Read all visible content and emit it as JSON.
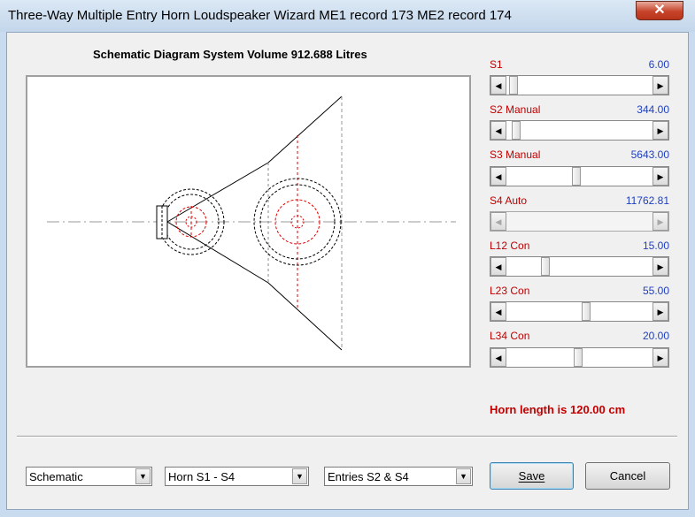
{
  "window": {
    "title": "Three-Way Multiple Entry Horn Loudspeaker Wizard   ME1 record 173   ME2 record 174",
    "close_symbol": "✕"
  },
  "diagram": {
    "heading": "Schematic Diagram   System Volume 912.688 Litres"
  },
  "sliders": [
    {
      "label": "S1",
      "value": "6.00",
      "position": 0.02,
      "enabled": true
    },
    {
      "label": "S2  Manual",
      "value": "344.00",
      "position": 0.04,
      "enabled": true
    },
    {
      "label": "S3  Manual",
      "value": "5643.00",
      "position": 0.48,
      "enabled": true
    },
    {
      "label": "S4  Auto",
      "value": "11762.81",
      "position": 0.0,
      "enabled": false
    },
    {
      "label": "L12  Con",
      "value": "15.00",
      "position": 0.25,
      "enabled": true
    },
    {
      "label": "L23  Con",
      "value": "55.00",
      "position": 0.55,
      "enabled": true
    },
    {
      "label": "L34  Con",
      "value": "20.00",
      "position": 0.49,
      "enabled": true
    }
  ],
  "horn_length_text": "Horn length is 120.00 cm",
  "combos": [
    {
      "name": "view-select",
      "value": "Schematic"
    },
    {
      "name": "horn-select",
      "value": "Horn S1 - S4"
    },
    {
      "name": "entries-select",
      "value": "Entries S2 & S4"
    }
  ],
  "buttons": {
    "save_label": "Save",
    "cancel_label": "Cancel"
  },
  "icons": {
    "scroll_left": "◀",
    "scroll_right": "▶",
    "dropdown": "▼"
  }
}
